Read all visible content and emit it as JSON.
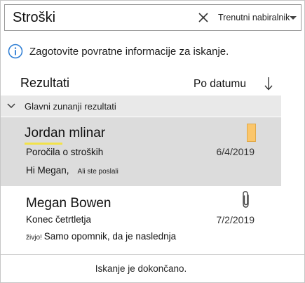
{
  "search": {
    "query": "Stroški",
    "scope": "Trenutni nabiralnik"
  },
  "feedback": {
    "text": "Zagotovite povratne informacije za iskanje."
  },
  "results": {
    "title": "Rezultati",
    "sort_label": "Po datumu",
    "group_label": "Glavni zunanji rezultati",
    "items": [
      {
        "sender": "Jordan mlinar",
        "subject": "Poročila o stroških",
        "preview_start": "Hi Megan,",
        "preview_rest": "Ali ste poslali",
        "date": "6/4/2019",
        "selected": true,
        "category_color": "#fbc66b"
      },
      {
        "sender": "Megan Bowen",
        "subject": "Konec četrtletja",
        "preview_start": "živjo!",
        "preview_rest": "Samo opomnik, da je naslednja",
        "date": "7/2/2019",
        "selected": false,
        "has_attachment": true
      }
    ]
  },
  "status": "Iskanje je dokončano.",
  "icons": {
    "clear": "close-icon",
    "scope_caret": "chevron-down-icon",
    "info": "info-icon",
    "sort_direction": "arrow-down-icon",
    "group_toggle": "chevron-down-icon",
    "category": "category-flag-icon",
    "attachment": "paperclip-icon"
  },
  "colors": {
    "info_blue": "#2b7cd3",
    "selected_bg": "#dcdcdc",
    "group_bg": "#e9e9e9",
    "highlight": "#f2e24a",
    "category": "#fbc66b"
  }
}
